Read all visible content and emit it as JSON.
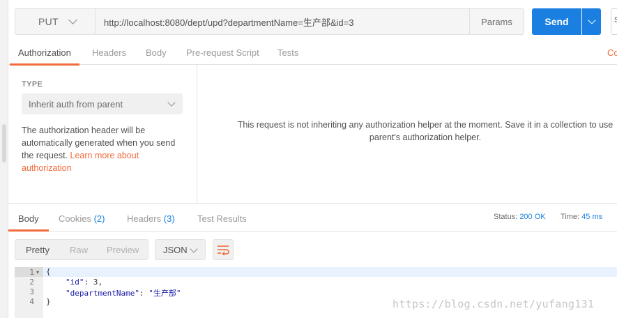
{
  "request": {
    "method": "PUT",
    "url": "http://localhost:8080/dept/upd?departmentName=生产部&id=3",
    "params_label": "Params",
    "send_label": "Send",
    "save_stub": "S"
  },
  "request_tabs": {
    "authorization": "Authorization",
    "headers": "Headers",
    "body": "Body",
    "prerequest": "Pre-request Script",
    "tests": "Tests",
    "cookies_stub": "Co"
  },
  "auth": {
    "type_label": "TYPE",
    "selected": "Inherit auth from parent",
    "desc_l1": "The authorization header will be",
    "desc_l2": "automatically generated when you send",
    "desc_l3a": "the request. ",
    "desc_l3b": "Learn more about",
    "desc_l4": "authorization",
    "msg_l1": "This request is not inheriting any authorization helper at the moment. Save it in a collection to use",
    "msg_l2": "parent's authorization helper."
  },
  "response_tabs": {
    "body": "Body",
    "cookies": "Cookies",
    "cookies_count": "(2)",
    "headers": "Headers",
    "headers_count": "(3)",
    "test_results": "Test Results"
  },
  "response_meta": {
    "status_label": "Status:",
    "status_value": "200 OK",
    "time_label": "Time:",
    "time_value": "45 ms"
  },
  "response_toolbar": {
    "pretty": "Pretty",
    "raw": "Raw",
    "preview": "Preview",
    "format": "JSON"
  },
  "code": {
    "line_numbers": [
      "1",
      "2",
      "3",
      "4"
    ],
    "l1": "{",
    "l2_key": "\"id\"",
    "l2_rest": ": 3,",
    "l3_key": "\"departmentName\"",
    "l3_colon": ": ",
    "l3_val": "\"生产部\"",
    "l4": "}"
  },
  "watermark": "https://blog.csdn.net/yufang131",
  "colors": {
    "accent": "#f26b3a",
    "primary": "#1a7fe0"
  }
}
